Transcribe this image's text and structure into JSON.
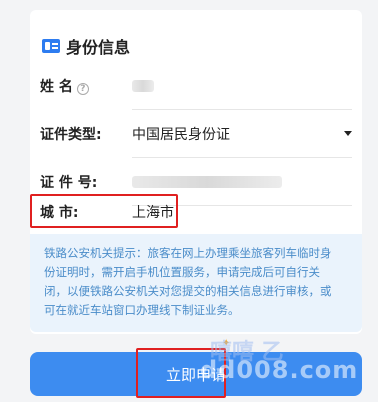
{
  "section": {
    "icon": "id-card-icon",
    "title": "身份信息"
  },
  "form": {
    "name_label": "姓    名",
    "id_type_label": "证件类型:",
    "id_type_value": "中国居民身份证",
    "id_number_label": "证 件 号:",
    "city_label": "城      市:",
    "city_value": "上海市"
  },
  "notice": {
    "text": "铁路公安机关提示：旅客在网上办理乘坐旅客列车临时身份证明时，需开启手机位置服务，申请完成后可自行关闭，以便铁路公安机关对您提交的相关信息进行审核，或可在就近车站窗口办理线下制证业务。"
  },
  "submit": {
    "label": "立即申请"
  },
  "watermark": {
    "text": "dd008.com",
    "cn": "嘻嘻 乙"
  },
  "colors": {
    "accent": "#3d8cf0",
    "notice_text": "#4a8cc9",
    "notice_bg": "#eaf3fc",
    "highlight": "#e02020"
  }
}
